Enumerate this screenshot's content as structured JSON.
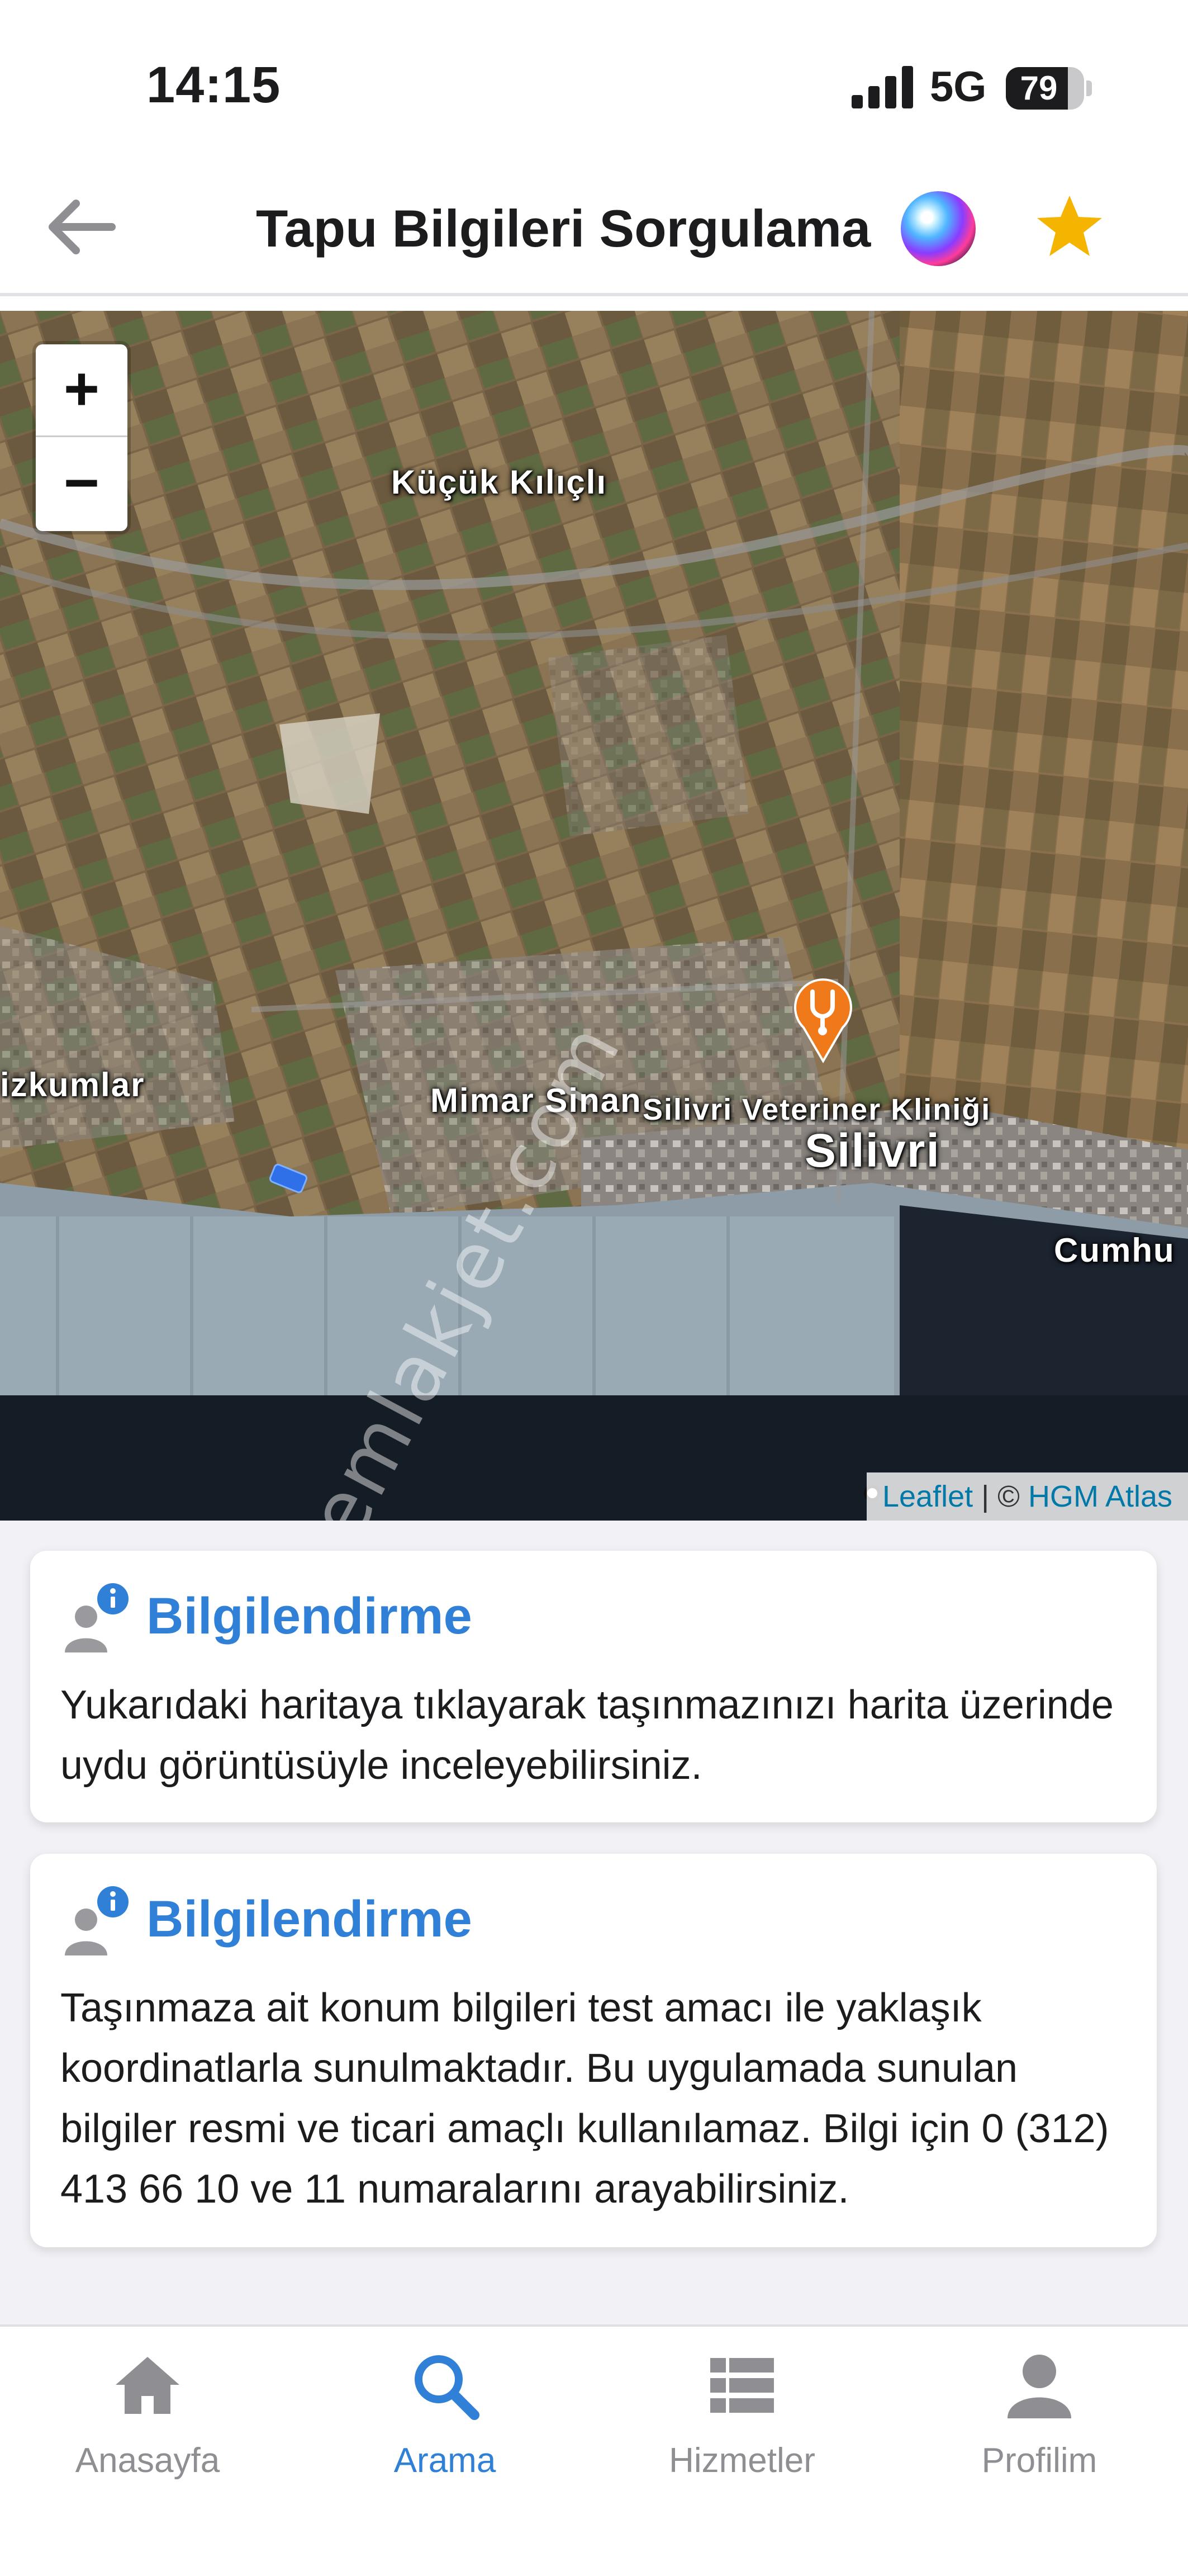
{
  "status_bar": {
    "time": "14:15",
    "network": "5G",
    "battery": "79",
    "battery_level_percent": 79,
    "icons": [
      "signal-icon",
      "battery-icon"
    ]
  },
  "header": {
    "title": "Tapu Bilgileri Sorgulama",
    "icons": [
      "back-arrow-icon",
      "siri-icon",
      "star-icon"
    ],
    "accent_color": "#2f80d6",
    "star_color": "#f5b400"
  },
  "map": {
    "zoom_in": "+",
    "zoom_out": "−",
    "labels": {
      "kucuk_kilicli": "Küçük Kılıçlı",
      "izkumlar": "izkumlar",
      "mimar_sinan": "Mimar Sinan",
      "veteriner": "Silivri Veteriner Kliniği",
      "silivri": "Silivri",
      "cumhu": "Cumhu"
    },
    "attribution": {
      "leaflet": "Leaflet",
      "separator": " | © ",
      "provider": "HGM Atlas"
    },
    "watermark": "emlakjet.com",
    "marker_icon": "veterinary-marker-icon"
  },
  "cards": [
    {
      "title": "Bilgilendirme",
      "icon": "user-info-icon",
      "text": "Yukarıdaki haritaya tıklayarak taşınmazınızı harita üzerinde uydu görüntüsüyle inceleyebilirsiniz."
    },
    {
      "title": "Bilgilendirme",
      "icon": "user-info-icon",
      "text": "Taşınmaza ait konum bilgileri test amacı ile yaklaşık koordinatlarla sunulmaktadır. Bu uygulamada sunulan bilgiler resmi ve ticari amaçlı kullanılamaz. Bilgi için 0 (312) 413 66 10 ve 11 numaralarını arayabilirsiniz."
    }
  ],
  "tabbar": {
    "active": "Arama",
    "tabs": [
      {
        "label": "Anasayfa",
        "icon": "home-icon"
      },
      {
        "label": "Arama",
        "icon": "search-icon"
      },
      {
        "label": "Hizmetler",
        "icon": "list-icon"
      },
      {
        "label": "Profilim",
        "icon": "profile-icon"
      }
    ],
    "active_color": "#2f80d6",
    "inactive_color": "#8e8e93"
  }
}
